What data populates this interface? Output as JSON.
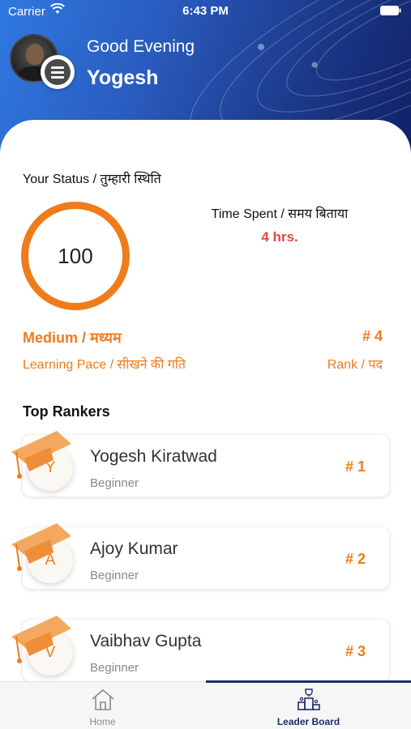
{
  "status_bar": {
    "carrier": "Carrier",
    "time": "6:43 PM"
  },
  "header": {
    "greeting": "Good Evening",
    "username": "Yogesh"
  },
  "status": {
    "title": "Your Status / तुम्हारी स्थिति",
    "score": "100",
    "time_title": "Time Spent / समय बिताया",
    "time_value": "4 hrs.",
    "pace_value": "Medium / मध्यम",
    "pace_label": "Learning Pace / सीखने की गति",
    "rank_value": "# 4",
    "rank_label": "Rank / पद"
  },
  "top_rankers": {
    "title": "Top Rankers",
    "items": [
      {
        "initial": "Y",
        "name": "Yogesh Kiratwad",
        "level": "Beginner",
        "rank": "# 1"
      },
      {
        "initial": "A",
        "name": "Ajoy Kumar",
        "level": "Beginner",
        "rank": "# 2"
      },
      {
        "initial": "V",
        "name": "Vaibhav Gupta",
        "level": "Beginner",
        "rank": "# 3"
      }
    ]
  },
  "tabbar": {
    "home_label": "Home",
    "leader_label": "Leader Board",
    "active": "Leader Board"
  },
  "colors": {
    "accent": "#ef7c1c",
    "time_value": "#e04848",
    "header_start": "#2f79e0",
    "header_end": "#102066",
    "active_tab": "#1c2f6b"
  },
  "icons": [
    "wifi-icon",
    "battery-icon",
    "menu-icon",
    "graduation-cap-icon",
    "home-icon",
    "podium-icon"
  ]
}
